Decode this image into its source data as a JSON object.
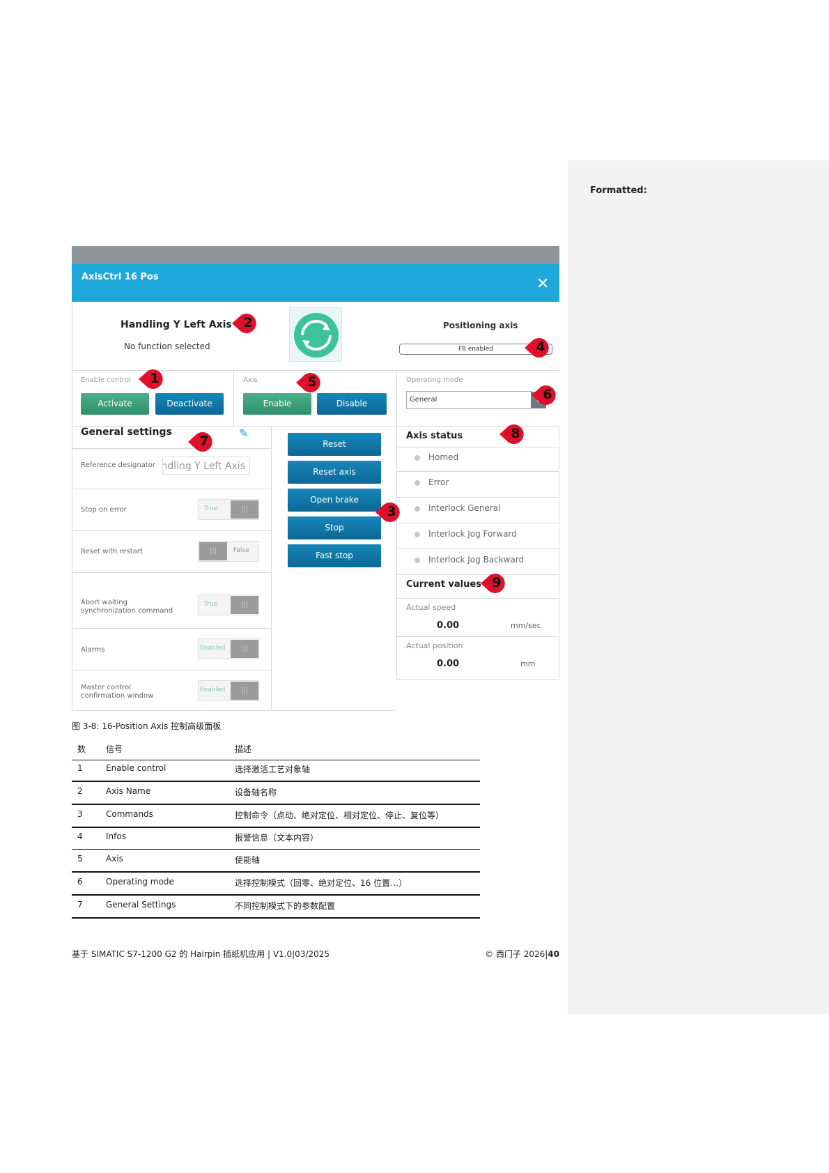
{
  "comments": {
    "title": "Formatted:"
  },
  "panel": {
    "window_title": "AxisCtrl 16 Pos",
    "close_glyph": "✕",
    "axis_name": "Handling Y Left Axis",
    "function_text": "No function selected",
    "axis_type": "Positioning axis",
    "info_text": "F8 enabled",
    "enable_control": {
      "label": "Enable control",
      "activate": "Activate",
      "deactivate": "Deactivate"
    },
    "axis": {
      "label": "Axis",
      "enable": "Enable",
      "disable": "Disable"
    },
    "operating_mode": {
      "label": "Operating mode",
      "value": "General"
    },
    "general_settings": {
      "title": "General settings",
      "reference_designator": {
        "label": "Reference designator",
        "value": "ındling Y Left Axis"
      },
      "rows": [
        {
          "label": "Stop on error",
          "value": "True"
        },
        {
          "label": "Reset with restart",
          "value": "False"
        },
        {
          "label": "Abort waiting synchronization command",
          "value": "True"
        },
        {
          "label": "Alarms",
          "value": "Enabled"
        },
        {
          "label": "Master control confirmation window",
          "value": "Enabled"
        }
      ]
    },
    "commands": [
      "Reset",
      "Reset axis",
      "Open brake",
      "Stop",
      "Fast stop"
    ],
    "axis_status": {
      "title": "Axis status",
      "items": [
        "Homed",
        "Error",
        "Interlock General",
        "Interlock Jog Forward",
        "Interlock Jog Backward"
      ]
    },
    "current_values": {
      "title": "Current values",
      "speed": {
        "label": "Actual speed",
        "value": "0.00",
        "unit": "mm/sec"
      },
      "position": {
        "label": "Actual position",
        "value": "0.00",
        "unit": "mm"
      }
    },
    "callouts": [
      "1",
      "2",
      "3",
      "4",
      "5",
      "6",
      "7",
      "8",
      "9"
    ],
    "callout_color": "#e0102a",
    "accent_color": "#1ea7d9"
  },
  "caption": "图 3-8: 16-Position Axis 控制高级面板",
  "table": {
    "headers": [
      "数",
      "信号",
      "描述"
    ],
    "rows": [
      {
        "num": "1",
        "signal": "Enable control",
        "desc": "选择激活工艺对象轴"
      },
      {
        "num": "2",
        "signal": "Axis Name",
        "desc": "设备轴名称"
      },
      {
        "num": "3",
        "signal": "Commands",
        "desc": "控制命令（点动、绝对定位、相对定位、停止、复位等）"
      },
      {
        "num": "4",
        "signal": "Infos",
        "desc": "报警信息（文本内容）"
      },
      {
        "num": "5",
        "signal": "Axis",
        "desc": "使能轴"
      },
      {
        "num": "6",
        "signal": "Operating mode",
        "desc": "选择控制模式（回零、绝对定位、16 位置…）"
      },
      {
        "num": "7",
        "signal": "General Settings",
        "desc": "不同控制模式下的参数配置"
      }
    ]
  },
  "footer": {
    "left": "基于 SIMATIC S7-1200 G2 的 Hairpin 插纸机应用 | V1.0|03/2025",
    "right_prefix": "© 西门子 2026|",
    "page": "40"
  }
}
